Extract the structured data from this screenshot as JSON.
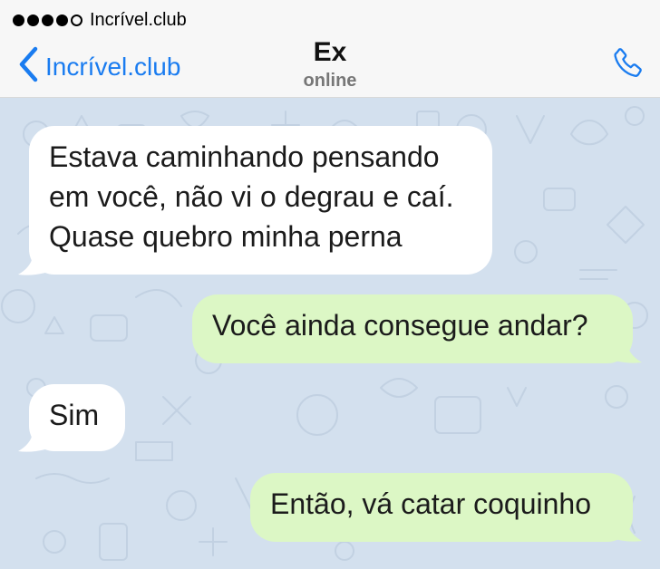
{
  "status_bar": {
    "carrier": "Incrível.club",
    "signal_filled": 4,
    "signal_total": 5
  },
  "header": {
    "back_label": "Incrível.club",
    "contact_name": "Ex",
    "contact_status": "online",
    "call_icon": "phone-icon"
  },
  "colors": {
    "accent": "#1a7cf0",
    "incoming_bubble": "#ffffff",
    "outgoing_bubble": "#dcf7c5",
    "chat_background": "#d3e0ee"
  },
  "messages": [
    {
      "direction": "incoming",
      "text": "Estava caminhando pensando\nem você, não vi o degrau e caí.\nQuase quebro minha perna"
    },
    {
      "direction": "outgoing",
      "text": "Você ainda consegue andar?"
    },
    {
      "direction": "incoming",
      "text": "Sim"
    },
    {
      "direction": "outgoing",
      "text": "Então, vá catar coquinho"
    }
  ]
}
